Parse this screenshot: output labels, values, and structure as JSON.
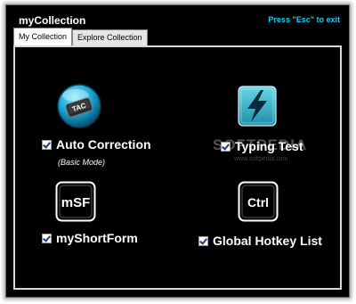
{
  "window": {
    "title": "myCollection",
    "hint": "Press \"Esc\" to exit"
  },
  "tabs": [
    {
      "label": "My Collection",
      "active": true
    },
    {
      "label": "Explore Collection",
      "active": false
    }
  ],
  "features": {
    "auto_correction": {
      "label": "Auto Correction",
      "subtitle": "(Basic Mode)",
      "checked": true,
      "icon": "tac-key-icon"
    },
    "typing_test": {
      "label": "Typing Test",
      "checked": true,
      "icon": "lightning-icon"
    },
    "myshortform": {
      "label": "myShortForm",
      "checked": true,
      "icon": "msf-key-icon",
      "icon_text": "mSF"
    },
    "global_hotkey": {
      "label": "Global Hotkey List",
      "checked": true,
      "icon": "ctrl-key-icon",
      "icon_text": "Ctrl"
    }
  },
  "watermark": {
    "text": "SOFTPEDIA",
    "url": "www.softpedia.com"
  },
  "colors": {
    "background": "#000000",
    "accent": "#22c8f0",
    "text": "#ffffff"
  }
}
